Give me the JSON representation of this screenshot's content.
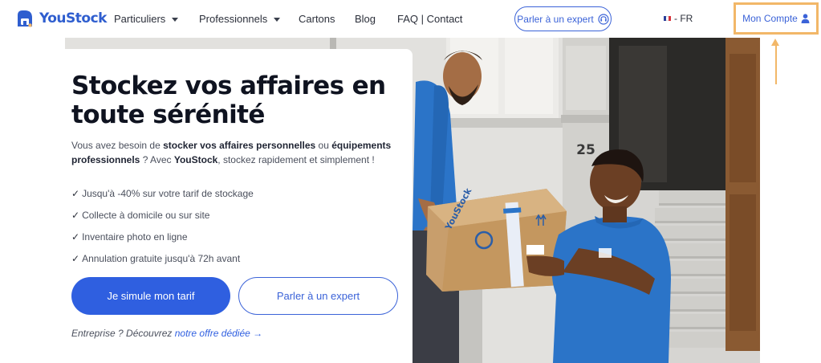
{
  "brand": {
    "name": "YouStock",
    "primary_color": "#2f5fe0",
    "accent_color": "#f2b768"
  },
  "nav": {
    "items": [
      {
        "label": "Particuliers",
        "icon": "caret-down-icon"
      },
      {
        "label": "Professionnels",
        "icon": "caret-down-icon"
      },
      {
        "label": "Cartons"
      },
      {
        "label": "Blog"
      },
      {
        "label": "FAQ | Contact"
      }
    ],
    "expert_button": {
      "label": "Parler à un expert",
      "icon": "headset-icon"
    },
    "language": {
      "label": "- FR",
      "icon": "france-flag-icon"
    },
    "account": {
      "label": "Mon Compte",
      "icon": "user-icon"
    }
  },
  "hero": {
    "title": "Stockez vos affaires en toute sérénité",
    "intro": {
      "part1": "Vous avez besoin de ",
      "bold1": "stocker vos affaires personnelles",
      "part2": " ou ",
      "bold2": "équipements professionnels",
      "part3": " ? Avec ",
      "bold3": "YouStock",
      "part4": ", stockez rapidement et simplement !"
    },
    "features": [
      {
        "check": "✓",
        "text": "Jusqu'à -40% sur votre tarif de stockage"
      },
      {
        "check": "✓",
        "text": "Collecte à domicile ou sur site"
      },
      {
        "check": "✓",
        "text": "Inventaire photo en ligne"
      },
      {
        "check": "✓",
        "text": "Annulation gratuite jusqu'à 72h avant"
      }
    ],
    "primary_button": "Je simule mon tarif",
    "secondary_button": "Parler à un expert",
    "enterprise": {
      "prefix": "Entreprise ? Découvrez ",
      "link": "notre offre dédiée",
      "arrow": "→"
    },
    "photo": {
      "house_number": "25",
      "box_brand": "YouStock"
    }
  }
}
